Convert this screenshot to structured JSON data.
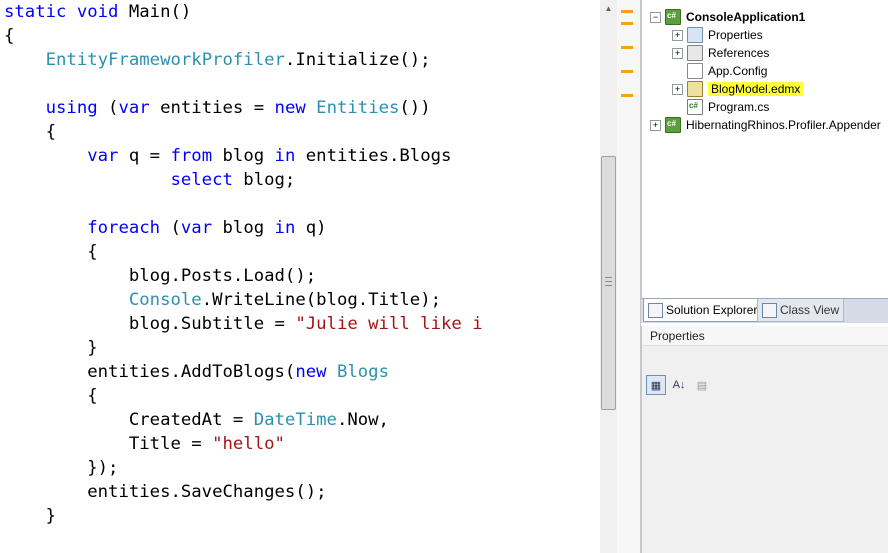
{
  "editor": {
    "lines": [
      [
        {
          "t": "static",
          "c": "kw"
        },
        {
          "t": " "
        },
        {
          "t": "void",
          "c": "kw"
        },
        {
          "t": " Main()"
        }
      ],
      [
        {
          "t": "{"
        }
      ],
      [
        {
          "t": "    "
        },
        {
          "t": "EntityFrameworkProfiler",
          "c": "typ"
        },
        {
          "t": ".Initialize();"
        }
      ],
      [
        {
          "t": ""
        }
      ],
      [
        {
          "t": "    "
        },
        {
          "t": "using",
          "c": "kw"
        },
        {
          "t": " ("
        },
        {
          "t": "var",
          "c": "kw"
        },
        {
          "t": " entities = "
        },
        {
          "t": "new",
          "c": "kw"
        },
        {
          "t": " "
        },
        {
          "t": "Entities",
          "c": "typ"
        },
        {
          "t": "())"
        }
      ],
      [
        {
          "t": "    {"
        }
      ],
      [
        {
          "t": "        "
        },
        {
          "t": "var",
          "c": "kw"
        },
        {
          "t": " q = "
        },
        {
          "t": "from",
          "c": "kw"
        },
        {
          "t": " blog "
        },
        {
          "t": "in",
          "c": "kw"
        },
        {
          "t": " entities.Blogs"
        }
      ],
      [
        {
          "t": "                "
        },
        {
          "t": "select",
          "c": "kw"
        },
        {
          "t": " blog;"
        }
      ],
      [
        {
          "t": ""
        }
      ],
      [
        {
          "t": "        "
        },
        {
          "t": "foreach",
          "c": "kw"
        },
        {
          "t": " ("
        },
        {
          "t": "var",
          "c": "kw"
        },
        {
          "t": " blog "
        },
        {
          "t": "in",
          "c": "kw"
        },
        {
          "t": " q)"
        }
      ],
      [
        {
          "t": "        {"
        }
      ],
      [
        {
          "t": "            blog.Posts.Load();"
        }
      ],
      [
        {
          "t": "            "
        },
        {
          "t": "Console",
          "c": "typ"
        },
        {
          "t": ".WriteLine(blog.Title);"
        }
      ],
      [
        {
          "t": "            blog.Subtitle = "
        },
        {
          "t": "\"Julie will like i",
          "c": "str"
        }
      ],
      [
        {
          "t": "        }"
        }
      ],
      [
        {
          "t": "        entities.AddToBlogs("
        },
        {
          "t": "new",
          "c": "kw"
        },
        {
          "t": " "
        },
        {
          "t": "Blogs",
          "c": "typ"
        }
      ],
      [
        {
          "t": "        {"
        }
      ],
      [
        {
          "t": "            CreatedAt = "
        },
        {
          "t": "DateTime",
          "c": "typ"
        },
        {
          "t": ".Now,"
        }
      ],
      [
        {
          "t": "            Title = "
        },
        {
          "t": "\"hello\"",
          "c": "str"
        }
      ],
      [
        {
          "t": "        });"
        }
      ],
      [
        {
          "t": "        entities.SaveChanges();"
        }
      ],
      [
        {
          "t": "    }"
        }
      ]
    ]
  },
  "solution_explorer": {
    "items": [
      {
        "label": "ConsoleApplication1",
        "icon": "csharp-project-icon",
        "expander": "−",
        "indent": 0,
        "bold": true
      },
      {
        "label": "Properties",
        "icon": "properties-icon",
        "expander": "+",
        "indent": 1
      },
      {
        "label": "References",
        "icon": "references-icon",
        "expander": "+",
        "indent": 1
      },
      {
        "label": "App.Config",
        "icon": "config-file-icon",
        "expander": "",
        "indent": 1
      },
      {
        "label": "BlogModel.edmx",
        "icon": "edmx-file-icon",
        "expander": "+",
        "indent": 1,
        "highlight": true
      },
      {
        "label": "Program.cs",
        "icon": "csharp-file-icon",
        "expander": "",
        "indent": 1
      },
      {
        "label": "HibernatingRhinos.Profiler.Appender",
        "icon": "csharp-project-icon",
        "expander": "+",
        "indent": 0
      }
    ]
  },
  "tabs": [
    {
      "label": "Solution Explorer",
      "active": true
    },
    {
      "label": "Class View",
      "active": false
    }
  ],
  "properties_panel": {
    "title": "Properties",
    "toolbar": {
      "categorized": "▦",
      "alphabetical": "A↓",
      "property_pages": "▤"
    }
  },
  "colors": {
    "keyword": "#0000ff",
    "type": "#2b91af",
    "string": "#a31515",
    "highlight": "#ffff3a",
    "change_mark": "#f7a11a"
  }
}
